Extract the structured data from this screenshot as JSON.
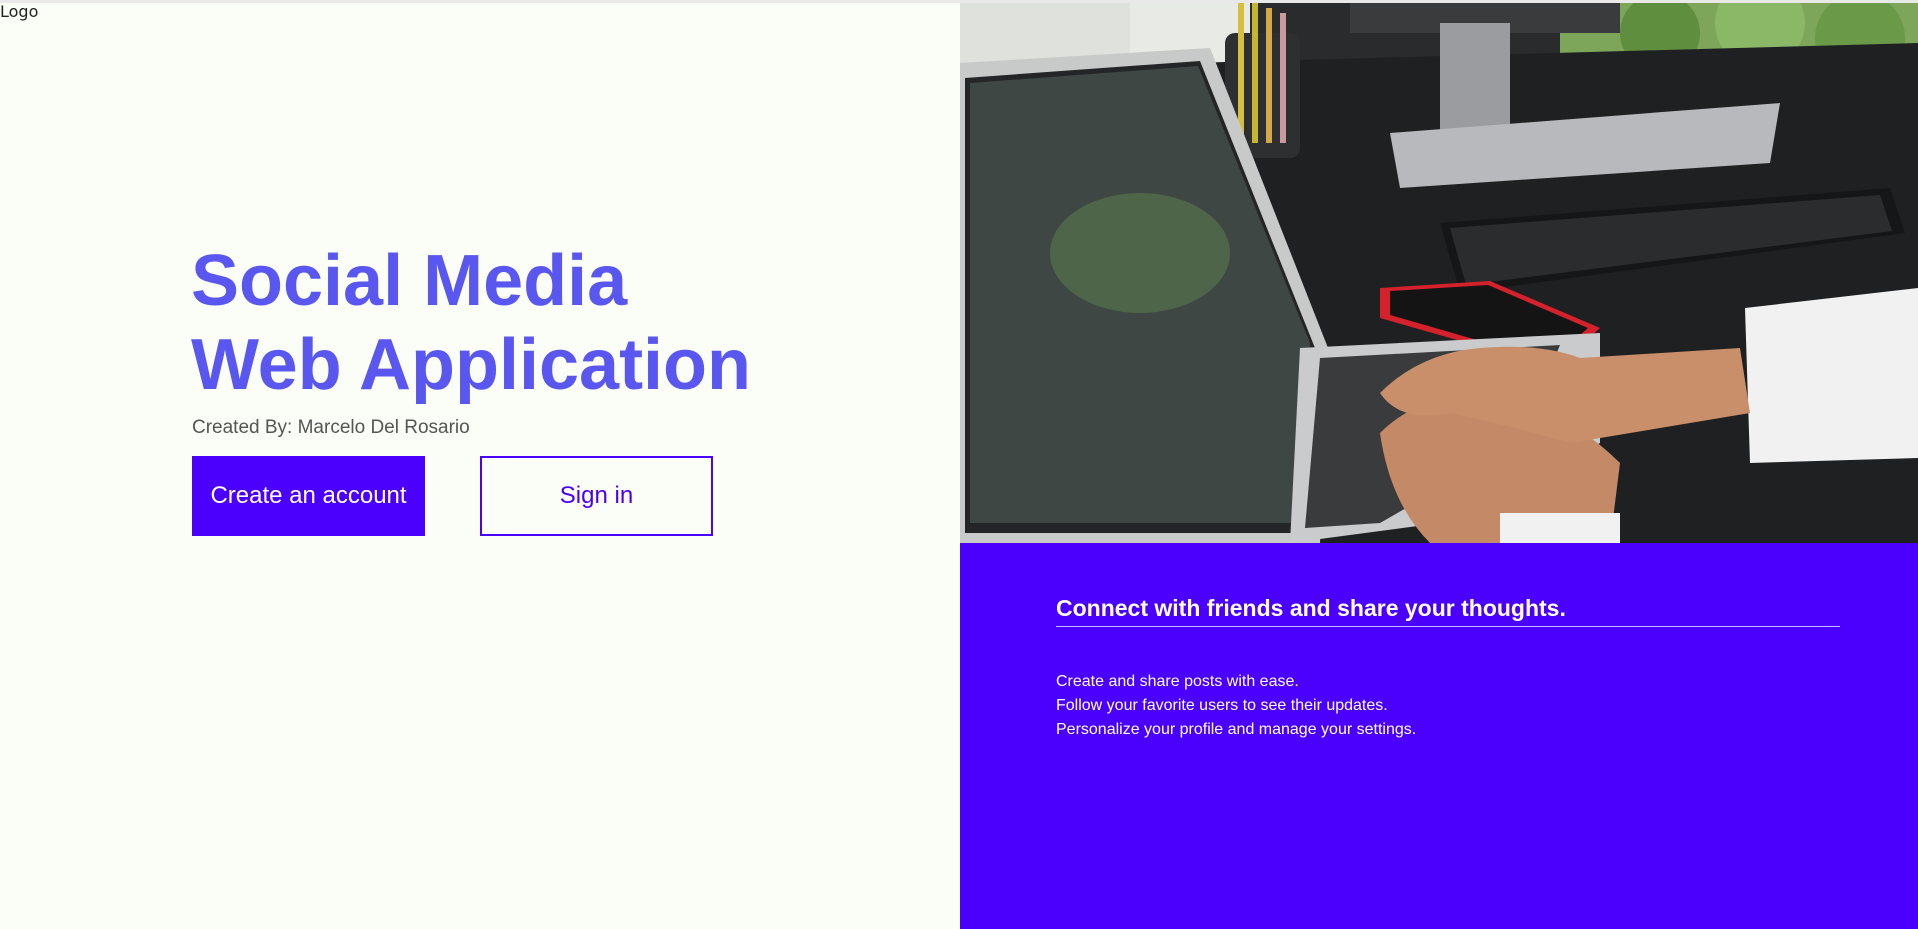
{
  "logo": "Logo",
  "hero": {
    "title_line1": "Social Media",
    "title_line2": "Web Application",
    "creator": "Created By: Marcelo Del Rosario"
  },
  "actions": {
    "create_account": "Create an account",
    "sign_in": "Sign in"
  },
  "panel": {
    "heading": "Connect with friends and share your thoughts.",
    "features": [
      "Create and share posts with ease.",
      "Follow your favorite users to see their updates.",
      "Personalize your profile and manage your settings."
    ]
  },
  "colors": {
    "accent": "#4a00fc",
    "title": "#5a57f0",
    "background": "#fbfef6"
  }
}
